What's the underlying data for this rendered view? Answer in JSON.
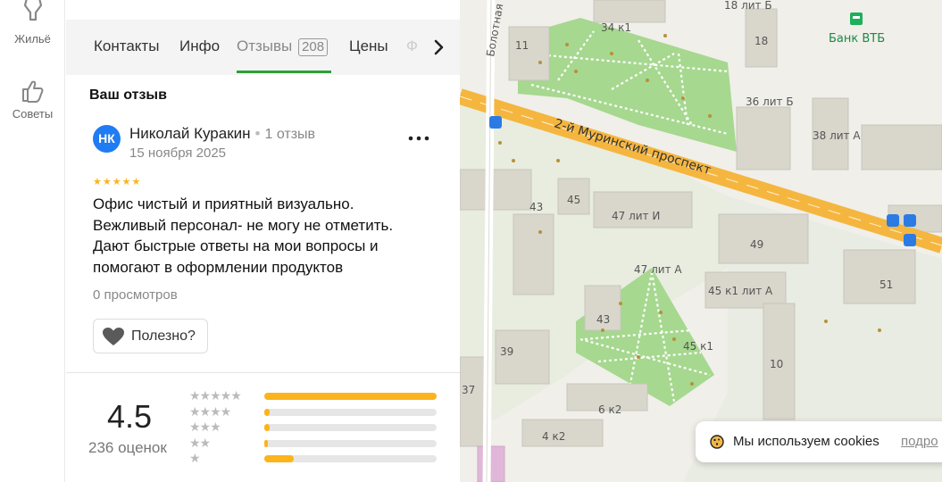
{
  "rail": {
    "items": [
      {
        "label": "Жильё",
        "icon": "housing-icon"
      },
      {
        "label": "Советы",
        "icon": "thumbs-up-icon"
      }
    ]
  },
  "tabs": {
    "items": [
      {
        "label": "Контакты"
      },
      {
        "label": "Инфо"
      },
      {
        "label": "Отзывы",
        "count": "208",
        "active": true
      },
      {
        "label": "Цены"
      },
      {
        "label": "Ф"
      }
    ],
    "next_icon": "chevron-right-icon",
    "accent": "#2f9e38"
  },
  "review": {
    "section_title": "Ваш отзыв",
    "avatar_initials": "НК",
    "avatar_color": "#1f7cf2",
    "author": "Николай Куракин",
    "author_reviews": "1 отзыв",
    "date": "15 ноября 2025",
    "stars": 5,
    "text_lines": [
      "Офис чистый и приятный визуально.",
      "Вежливый персонал- не могу не отметить.",
      "Дают быстрые ответы на мои вопросы и",
      "помогают в оформлении продуктов"
    ],
    "views": "0 просмотров",
    "helpful_label": "Полезно?",
    "more_icon": "more-dots-icon",
    "helpful_icon": "heart-icon"
  },
  "rating": {
    "value": "4.5",
    "count_label": "236 оценок",
    "distribution": [
      {
        "stars": 5,
        "share": 1.0
      },
      {
        "stars": 4,
        "share": 0.03
      },
      {
        "stars": 3,
        "share": 0.03
      },
      {
        "stars": 2,
        "share": 0.01
      },
      {
        "stars": 1,
        "share": 0.17
      }
    ],
    "bar_color": "#fcb41c"
  },
  "map": {
    "street_main": "2-й Муринский проспект",
    "street_side": "Болотная",
    "poi": "Банк ВТБ",
    "house_labels": [
      "34 к1",
      "18 лит Б",
      "18",
      "11",
      "36 лит Б",
      "38 лит А",
      "45",
      "43",
      "47 лит И",
      "49",
      "47 лит А",
      "45 к1 лит А",
      "51",
      "43",
      "45 к1",
      "39",
      "10",
      "37",
      "6 к2",
      "4 к2"
    ]
  },
  "cookie": {
    "message": "Мы используем cookies",
    "link": "подро",
    "icon": "cookie-icon"
  }
}
